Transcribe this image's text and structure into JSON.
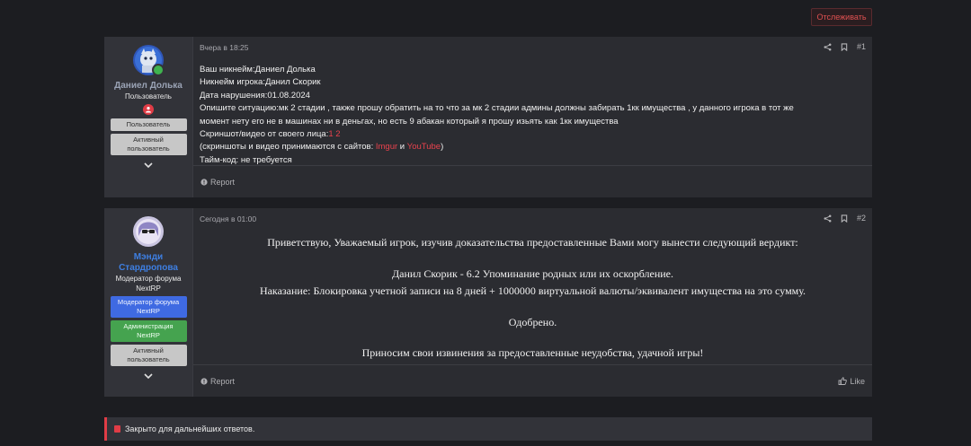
{
  "header": {
    "follow_label": "Отслеживать"
  },
  "post1": {
    "username": "Даниел Долька",
    "usertitle": "Пользователь",
    "banners": [
      "Пользователь",
      "Активный пользователь"
    ],
    "date": "Вчера в 18:25",
    "number": "#1",
    "lines": {
      "l1": "Ваш никнейм:Даниел Долька",
      "l2": "Никнейм игрока:Данил Скорик",
      "l3": "Дата нарушения:01.08.2024",
      "l4": "Опишите ситуацию:мк 2 стадии , также прошу обратить на то что за мк 2 стадии админы должны забирать 1кк имущества , у данного игрока в тот же",
      "l5": "момент нету его не в машинах ни в деньгах, но есть 9 абакан который я прошу изьять как 1кк имущества",
      "l6_prefix": "Скриншот/видео от своего лица:",
      "l6_link1": "1",
      "l6_link2": "2",
      "l7_prefix": "(скриншоты и видео принимаются с сайтов: ",
      "l7_imgur": "Imgur",
      "l7_and": " и ",
      "l7_youtube": "YouTube",
      "l7_suffix": ")",
      "l8": "Тайм-код: не требуется"
    },
    "report_label": "Report"
  },
  "post2": {
    "username_line1": "Мэнди",
    "username_line2": "Стардропова",
    "usertitle": "Модератор форума NextRP",
    "banners": [
      "Модератор форума NextRP",
      "Администрация NextRP",
      "Активный пользователь"
    ],
    "date": "Сегодня в 01:00",
    "number": "#2",
    "paragraphs": {
      "p1": "Приветствую, Уважаемый игрок, изучив доказательства предоставленные Вами могу вынести следующий вердикт:",
      "p2": "Данил Скорик - 6.2 Упоминание родных или их оскорбление.",
      "p3": "Наказание: Блокировка учетной записи на 8 дней + 1000000 виртуальной валюты/эквивалент имущества на это сумму.",
      "p4": "Одобрено.",
      "p5": "Приносим свои извинения за предоставленные неудобства, удачной игры!"
    },
    "report_label": "Report",
    "like_label": "Like"
  },
  "closed_notice": "Закрыто для дальнейших ответов.",
  "colors": {
    "accent_red": "#e03c46",
    "moderator_blue": "#3f6ae2",
    "admin_green": "#45a34f"
  }
}
